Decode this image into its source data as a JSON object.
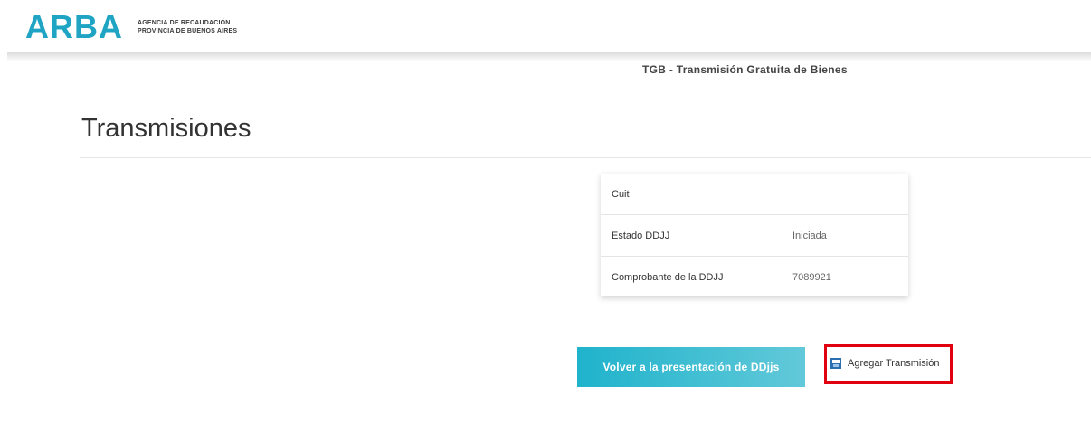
{
  "header": {
    "logo_mark": "ARBA",
    "logo_line1": "AGENCIA DE RECAUDACIÓN",
    "logo_line2": "PROVINCIA DE BUENOS AIRES",
    "system_title": "TGB - Transmisión Gratuita de Bienes"
  },
  "page": {
    "title": "Transmisiones"
  },
  "info_card": {
    "rows": [
      {
        "label": "Cuit",
        "value": ""
      },
      {
        "label": "Estado DDJJ",
        "value": "Iniciada"
      },
      {
        "label": "Comprobante de la DDJJ",
        "value": "7089921"
      }
    ]
  },
  "actions": {
    "back_label": "Volver a la presentación de DDjjs",
    "add_label": "Agregar Transmisión",
    "add_icon": "add-document-icon",
    "highlight_color": "#e0000f",
    "accent_color": "#1fb3cc"
  }
}
